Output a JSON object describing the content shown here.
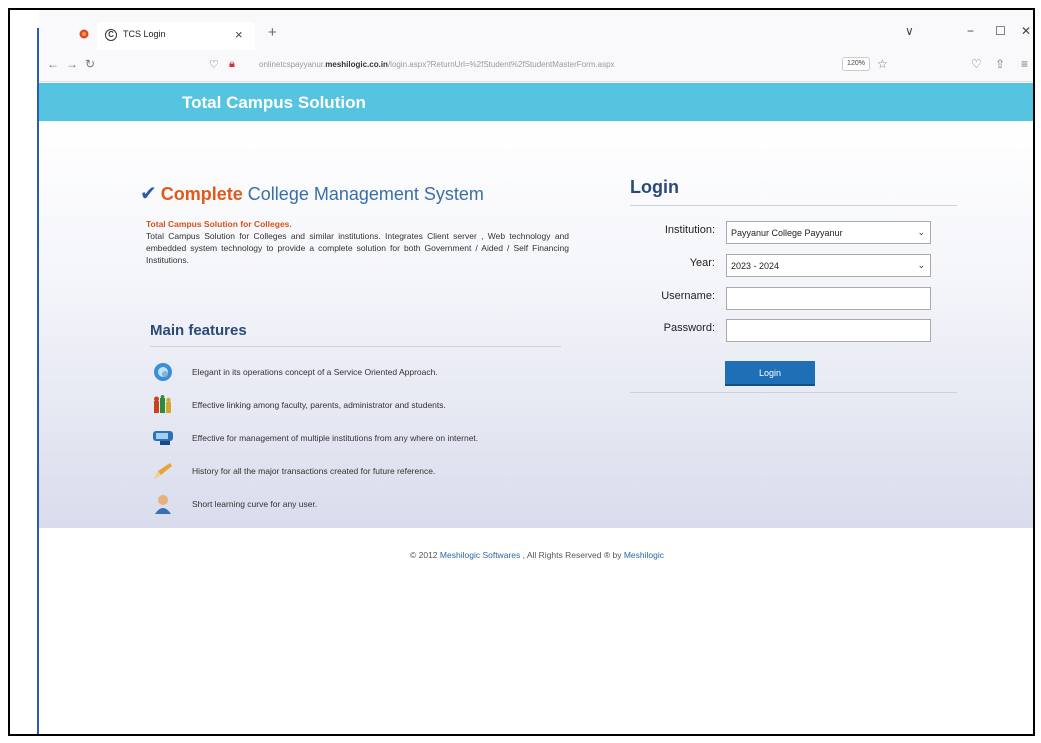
{
  "browser": {
    "tab_title": "TCS Login",
    "url_prefix": "onlinetcspayyanur.",
    "url_domain": "meshilogic.co.in",
    "url_suffix": "/login.aspx?ReturnUrl=%2fStudent%2fStudentMasterForm.aspx",
    "zoom": "120%"
  },
  "header": {
    "title": "Total Campus Solution"
  },
  "intro": {
    "title_highlight": "Complete",
    "title_rest": "College Management System",
    "subtitle": "Total Campus Solution for Colleges.",
    "description": "Total Campus Solution for Colleges and similar institutions. Integrates Client server , Web technology and embedded system technology to provide a complete solution for both Government / Aided / Self Financing Institutions."
  },
  "features": {
    "title": "Main features",
    "items": [
      {
        "text": "Elegant in its operations concept of a Service Oriented Approach.",
        "icon": "globe-icon"
      },
      {
        "text": "Effective linking among faculty, parents, administrator and students.",
        "icon": "people-icon"
      },
      {
        "text": "Effective for management of multiple institutions from any where on internet.",
        "icon": "network-icon"
      },
      {
        "text": "History for all the major transactions created for future reference.",
        "icon": "pencil-icon"
      },
      {
        "text": "Short learning curve for any user.",
        "icon": "user-icon"
      }
    ]
  },
  "login": {
    "title": "Login",
    "institution_label": "Institution:",
    "institution_value": "Payyanur College Payyanur",
    "year_label": "Year:",
    "year_value": "2023 - 2024",
    "username_label": "Username:",
    "username_value": "",
    "password_label": "Password:",
    "password_value": "",
    "button": "Login"
  },
  "footer": {
    "copyright": "© 2012",
    "company": "Meshilogic Softwares",
    "rights": ", All Rights Reserved ® by",
    "brand": "Meshilogic"
  },
  "colors": {
    "header": "#55c4e0",
    "accent": "#e05a1c",
    "button": "#1e6fb6"
  }
}
